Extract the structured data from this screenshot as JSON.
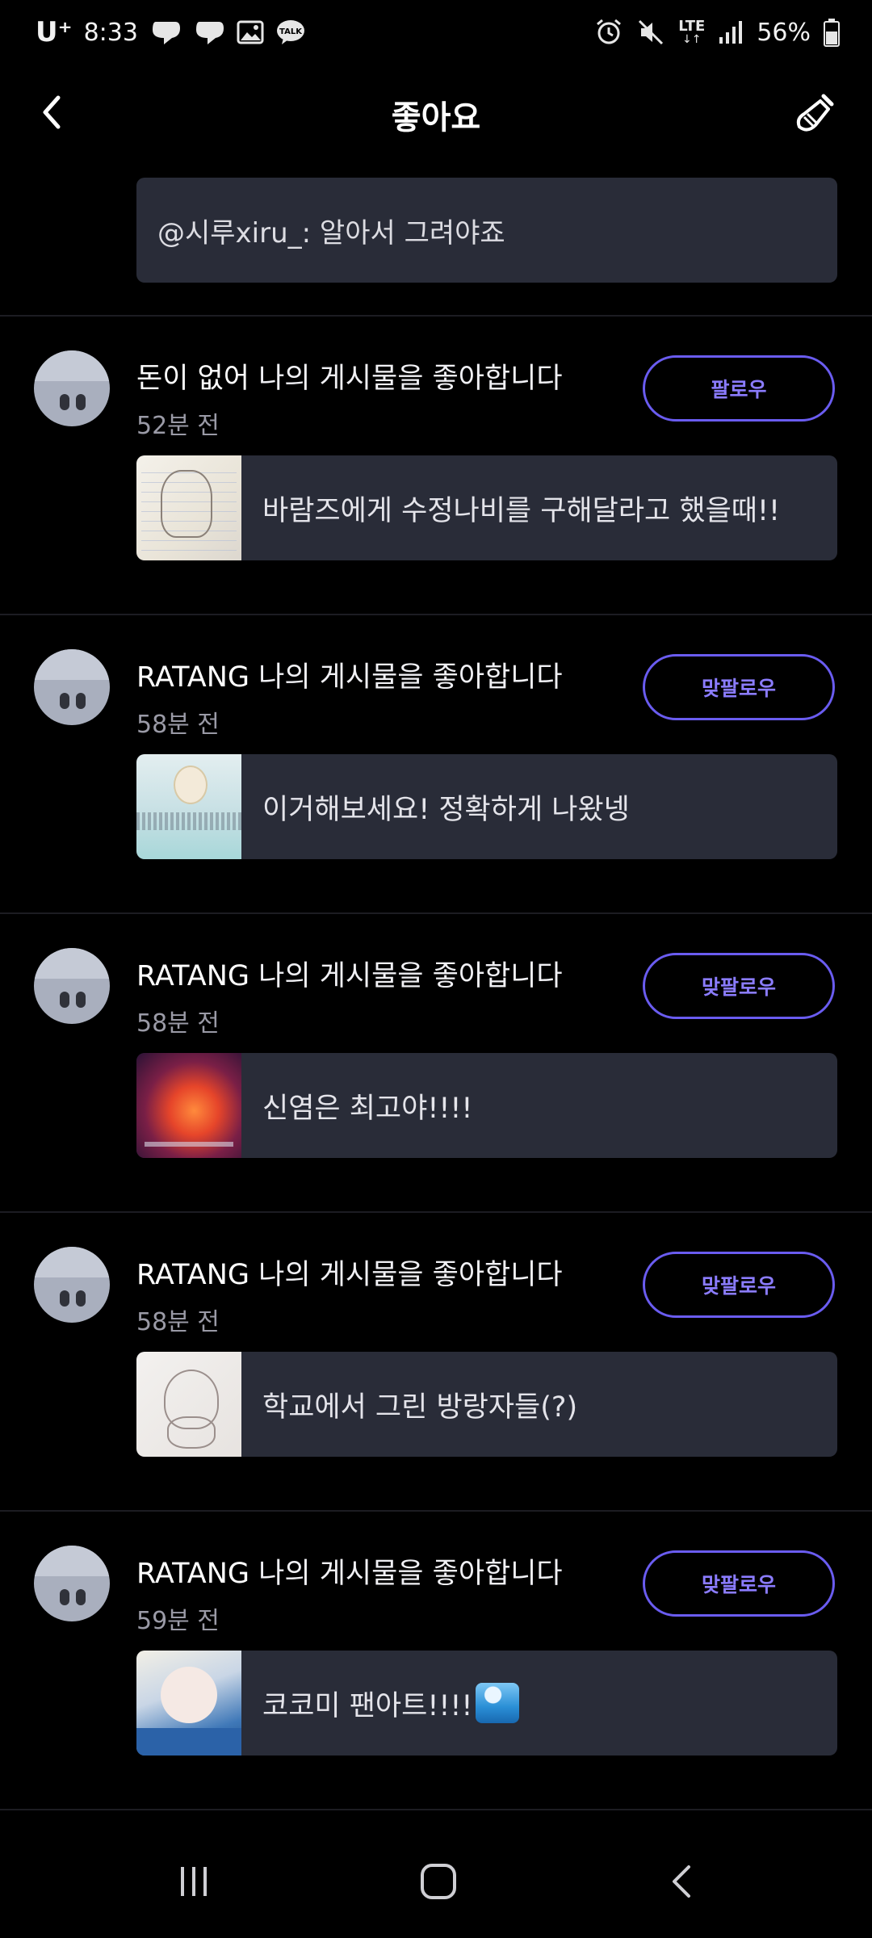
{
  "status_bar": {
    "carrier": "U⁺",
    "time": "8:33",
    "left_icons": [
      "chat-bubble-icon",
      "chat-bubble-icon",
      "gallery-icon",
      "kakaotalk-icon"
    ],
    "talk_label": "TALK",
    "right_icons": [
      "alarm-icon",
      "mute-icon",
      "lte-icon",
      "signal-icon",
      "battery-icon"
    ],
    "network": "LTE",
    "battery": "56%"
  },
  "header": {
    "title": "좋아요"
  },
  "top_comment": {
    "text": "@시루xiru_: 알아서 그려야죠"
  },
  "notifications": [
    {
      "username": "돈이 없어",
      "action": " 나의 게시물을 좋아합니다",
      "time": "52분 전",
      "follow_label": "팔로우",
      "post_title": "바람즈에게 수정나비를 구해달라고 했을때!!"
    },
    {
      "username": "RATANG",
      "action": " 나의 게시물을 좋아합니다",
      "time": "58분 전",
      "follow_label": "맞팔로우",
      "post_title": "이거해보세요! 정확하게 나왔넹"
    },
    {
      "username": "RATANG",
      "action": " 나의 게시물을 좋아합니다",
      "time": "58분 전",
      "follow_label": "맞팔로우",
      "post_title": "신염은 최고야!!!!"
    },
    {
      "username": "RATANG",
      "action": " 나의 게시물을 좋아합니다",
      "time": "58분 전",
      "follow_label": "맞팔로우",
      "post_title": "학교에서 그린 방랑자들(?)"
    },
    {
      "username": "RATANG",
      "action": " 나의 게시물을 좋아합니다",
      "time": "59분 전",
      "follow_label": "맞팔로우",
      "post_title": "코코미 팬아트!!!!"
    }
  ],
  "nav_bar": {
    "buttons": [
      "recent-apps-icon",
      "home-icon",
      "back-icon"
    ]
  },
  "colors": {
    "background": "#000000",
    "card": "#292c38",
    "accent": "#6a5cf0"
  }
}
